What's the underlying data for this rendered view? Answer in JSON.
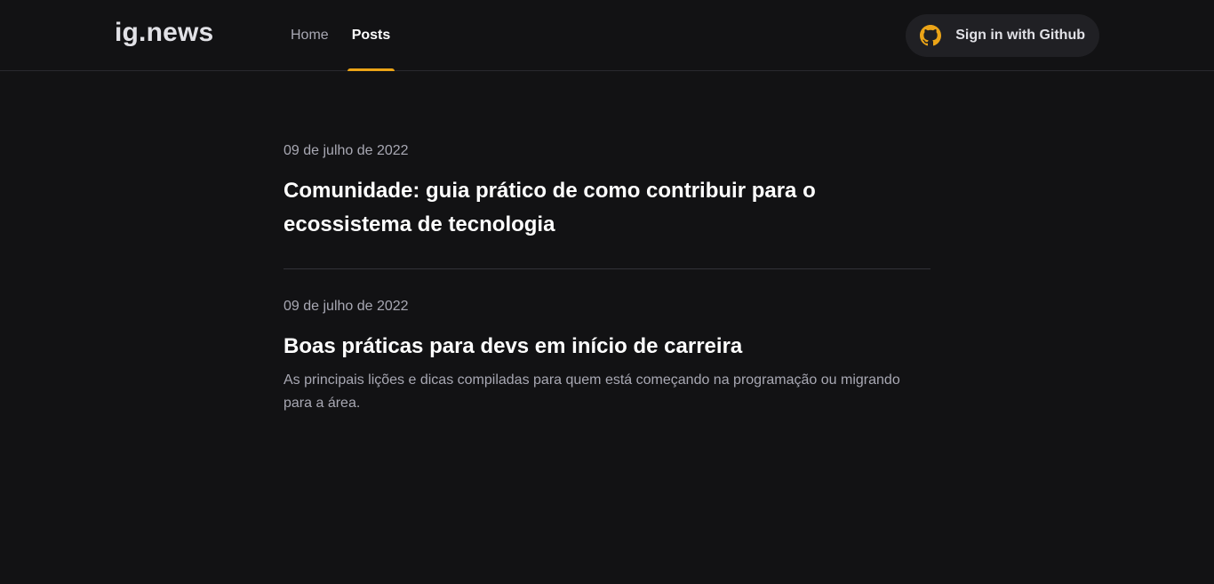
{
  "header": {
    "logo": "ig.news",
    "nav": [
      {
        "label": "Home",
        "active": false
      },
      {
        "label": "Posts",
        "active": true
      }
    ],
    "signin_label": "Sign in with Github",
    "signin_icon": "github-icon"
  },
  "colors": {
    "background": "#121214",
    "accent": "#eba417",
    "text_primary": "#ffffff",
    "text_secondary": "#a8a8b3",
    "button_bg": "#202024"
  },
  "posts": [
    {
      "date": "09 de julho de 2022",
      "title": "Comunidade: guia prático de como contribuir para o ecossistema de tecnologia",
      "excerpt": ""
    },
    {
      "date": "09 de julho de 2022",
      "title": "Boas práticas para devs em início de carreira",
      "excerpt": "As principais lições e dicas compiladas para quem está começando na programação ou migrando para a área."
    }
  ]
}
